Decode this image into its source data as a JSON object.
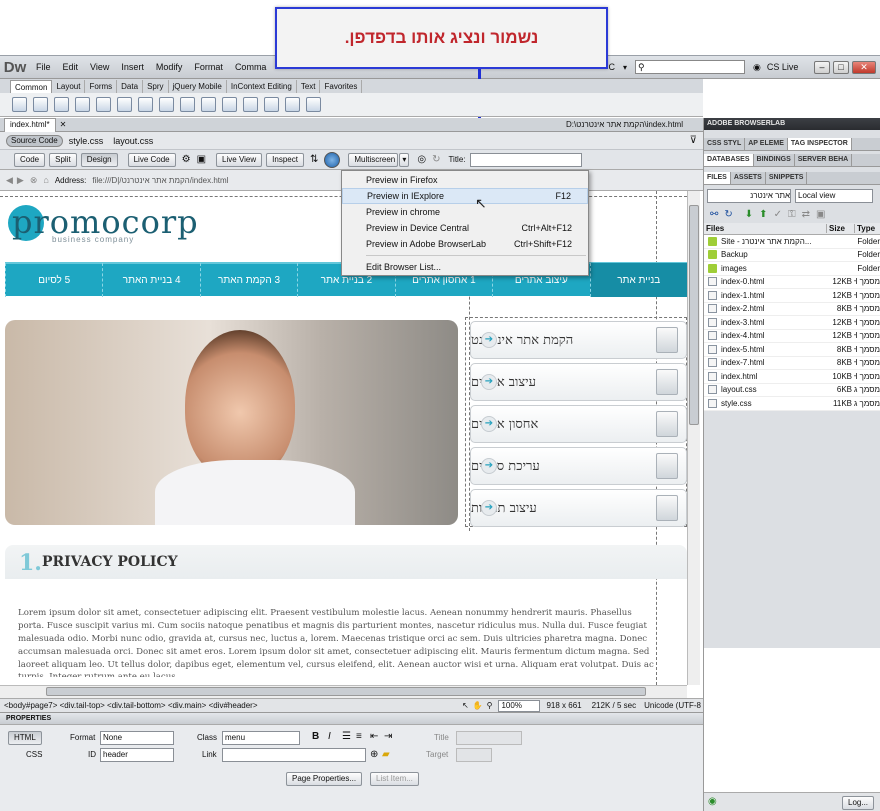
{
  "callout": {
    "text": "נשמור ונציג אותו בדפדפן."
  },
  "menubar": {
    "logo": "Dw",
    "items": [
      "File",
      "Edit",
      "View",
      "Insert",
      "Modify",
      "Format",
      "Comma"
    ],
    "partial_letter": "C",
    "cs_live": "CS Live"
  },
  "insert_tabs": [
    "Common",
    "Layout",
    "Forms",
    "Data",
    "Spry",
    "jQuery Mobile",
    "InContext Editing",
    "Text",
    "Favorites"
  ],
  "document": {
    "tab": "index.html*",
    "path": "D:\\הקמת אתר אינטרנט\\index.html",
    "source_code": "Source Code",
    "related_files": [
      "style.css",
      "layout.css"
    ],
    "view_buttons": [
      "Code",
      "Split",
      "Design"
    ],
    "live_code": "Live Code",
    "live_view": "Live View",
    "inspect": "Inspect",
    "multiscreen": "Multiscreen",
    "title_label": "Title:",
    "address_label": "Address:",
    "address_value": "file:///D|/הקמת אתר אינטרנט/index.html"
  },
  "preview_menu": {
    "items": [
      {
        "label": "Preview in Firefox",
        "shortcut": ""
      },
      {
        "label": "Preview in IExplore",
        "shortcut": "F12"
      },
      {
        "label": "Preview in chrome",
        "shortcut": ""
      },
      {
        "label": "Preview in Device Central",
        "shortcut": "Ctrl+Alt+F12"
      },
      {
        "label": "Preview in Adobe BrowserLab",
        "shortcut": "Ctrl+Shift+F12"
      }
    ],
    "edit": "Edit Browser List..."
  },
  "site": {
    "logo_main": "promocorp",
    "logo_sub": "business company",
    "nav": [
      "בניית אתר",
      "עיצוב אתרים",
      "1 אחסון אתרים",
      "2 בניית אתר",
      "3 הקמת האתר",
      "4 בניית האתר",
      "5 לסיום"
    ],
    "services": [
      "הקמת אתר אינטרנט",
      "עיצוב אתרים",
      "אחסון אתרים",
      "עריכת סרטים",
      "עיצוב תמונות"
    ],
    "privacy_number": "1.",
    "privacy_title": "PRIVACY POLICY",
    "lorem": "Lorem ipsum dolor sit amet, consectetuer adipiscing elit. Praesent vestibulum molestie lacus. Aenean nonummy hendrerit mauris. Phasellus porta. Fusce suscipit varius mi. Cum sociis natoque penatibus et magnis dis parturient montes, nascetur ridiculus mus. Nulla dui. Fusce feugiat malesuada odio. Morbi nunc odio, gravida at, cursus nec, luctus a, lorem. Maecenas tristique orci ac sem. Duis ultricies pharetra magna. Donec accumsan malesuada orci. Donec sit amet eros. Lorem ipsum dolor sit amet, consectetuer adipiscing elit. Mauris fermentum dictum magna. Sed laoreet aliquam leo. Ut tellus dolor, dapibus eget, elementum vel, cursus eleifend, elit. Aenean auctor wisi et urna. Aliquam erat volutpat. Duis ac turpis. Integer rutrum ante eu lacus."
  },
  "statusbar": {
    "tags": "<body#page7> <div.tail-top> <div.tail-bottom> <div.main> <div#header>",
    "zoom": "100%",
    "size": "918 x 661",
    "weight": "212K / 5 sec",
    "encoding": "Unicode (UTF-8"
  },
  "properties": {
    "title": "PROPERTIES",
    "html": "HTML",
    "css": "CSS",
    "format_label": "Format",
    "format_value": "None",
    "class_label": "Class",
    "class_value": "menu",
    "id_label": "ID",
    "id_value": "header",
    "link_label": "Link",
    "title_label": "Title",
    "target_label": "Target",
    "page_props": "Page Properties...",
    "list_item": "List Item..."
  },
  "side": {
    "browserlab": "ADOBE BROWSERLAB",
    "tabs1": [
      "CSS STYL",
      "AP ELEME",
      "TAG INSPECTOR"
    ],
    "tabs2": [
      "DATABASES",
      "BINDINGS",
      "SERVER BEHA"
    ],
    "tabs3": [
      "FILES",
      "ASSETS",
      "SNIPPETS"
    ],
    "site_select": "אתר אינטרנ",
    "view_select": "Local view",
    "headers": [
      "Files",
      "Size",
      "Type"
    ],
    "files": [
      {
        "name": "Site - הקמת אתר אינטרנ...",
        "size": "",
        "type": "Folder",
        "kind": "folder"
      },
      {
        "name": "Backup",
        "size": "",
        "type": "Folder",
        "kind": "folder"
      },
      {
        "name": "images",
        "size": "",
        "type": "Folder",
        "kind": "folder"
      },
      {
        "name": "index-0.html",
        "size": "12KB",
        "type": "מסמך H",
        "kind": "file"
      },
      {
        "name": "index-1.html",
        "size": "12KB",
        "type": "מסמך H",
        "kind": "file"
      },
      {
        "name": "index-2.html",
        "size": "8KB",
        "type": "מסמך H",
        "kind": "file"
      },
      {
        "name": "index-3.html",
        "size": "12KB",
        "type": "מסמך H",
        "kind": "file"
      },
      {
        "name": "index-4.html",
        "size": "12KB",
        "type": "מסמך H",
        "kind": "file"
      },
      {
        "name": "index-5.html",
        "size": "8KB",
        "type": "מסמך H",
        "kind": "file"
      },
      {
        "name": "index-7.html",
        "size": "8KB",
        "type": "מסמך H",
        "kind": "file"
      },
      {
        "name": "index.html",
        "size": "10KB",
        "type": "מסמך H",
        "kind": "file"
      },
      {
        "name": "layout.css",
        "size": "6KB",
        "type": "מסמך ג",
        "kind": "file"
      },
      {
        "name": "style.css",
        "size": "11KB",
        "type": "מסמך ג",
        "kind": "file"
      }
    ],
    "log": "Log..."
  }
}
